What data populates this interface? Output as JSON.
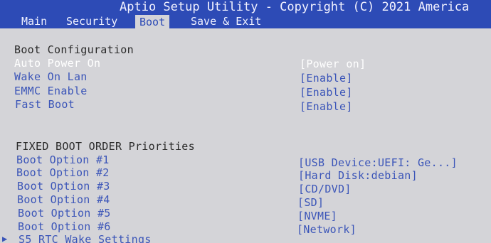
{
  "title": "Aptio Setup Utility - Copyright (C) 2021 America",
  "tabs": [
    "Main",
    "Security",
    "Boot",
    "Save & Exit"
  ],
  "active_tab": "Boot",
  "boot_config": {
    "header": "Boot Configuration",
    "items": [
      {
        "label": "Auto Power On",
        "value": "[Power on]"
      },
      {
        "label": "Wake On Lan",
        "value": "[Enable]"
      },
      {
        "label": "EMMC Enable",
        "value": "[Enable]"
      },
      {
        "label": "Fast Boot",
        "value": "[Enable]"
      }
    ]
  },
  "boot_order": {
    "header": "FIXED BOOT ORDER Priorities",
    "items": [
      {
        "label": "Boot Option #1",
        "value": "[USB Device:UEFI: Ge...]"
      },
      {
        "label": "Boot Option #2",
        "value": "[Hard Disk:debian]"
      },
      {
        "label": "Boot Option #3",
        "value": "[CD/DVD]"
      },
      {
        "label": "Boot Option #4",
        "value": "[SD]"
      },
      {
        "label": "Boot Option #5",
        "value": "[NVME]"
      },
      {
        "label": "Boot Option #6",
        "value": "[Network]"
      }
    ]
  },
  "submenu": {
    "label": "S5 RTC Wake Settings",
    "icon": "triangle-right-icon"
  },
  "colors": {
    "titlebar_bg": "#2d4bb6",
    "content_bg": "#d4d4d8",
    "item_text": "#3b55b8",
    "selected_text": "#ffffff",
    "header_text": "#2a2a2a"
  }
}
